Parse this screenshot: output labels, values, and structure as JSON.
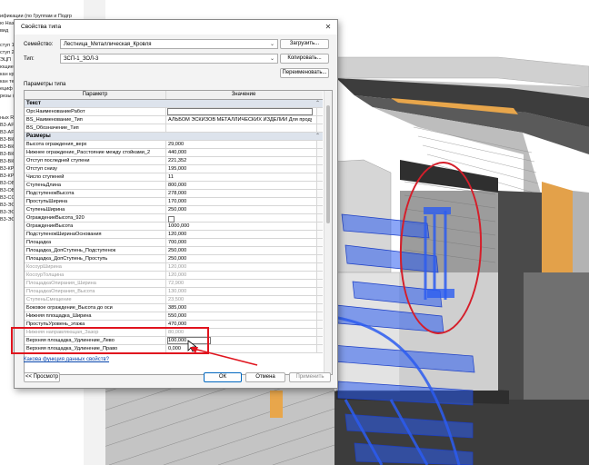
{
  "colors": {
    "accent": "#0067c0",
    "annotation": "#e0141e",
    "group_row": "#dde3ec",
    "concrete_dark": "#3a3a3a",
    "insulation_orange": "#e8a64b",
    "stair_blue": "#2c5cf0"
  },
  "project_browser": {
    "lines": [
      "ификации (по Группам и Подгр",
      "ю Наз",
      "вид",
      "",
      "ступ 1",
      "ступ 2",
      "ЭЦП",
      "ющие",
      "кан кр",
      "кан те",
      "ециф",
      "резы (",
      "",
      "",
      "ных Rev",
      "В3-АР",
      "В3-АР",
      "В3-ВК",
      "В3-ВК",
      "В3-ВК",
      "В3-ВК",
      "В3-КР",
      "В3-КР",
      "В3-ОВ",
      "В3-ОВ",
      "В3-СС",
      "В3-ЭС",
      "В3-ЭС",
      "В3-ЭС"
    ]
  },
  "dialog": {
    "title": "Свойства типа",
    "family_label": "Семейство:",
    "family_value": "Лестница_Металлическая_Кровля",
    "type_label": "Тип:",
    "type_value": "ЗСП-1_ЗОЛ-3",
    "load_button": "Загрузить...",
    "duplicate_button": "Копировать...",
    "rename_button": "Переименовать...",
    "section_label": "Параметры типа",
    "col_param": "Параметр",
    "col_value": "Значение",
    "help_link": "Какова функция данных свойств?",
    "preview_button": "<< Просмотр",
    "ok_button": "ОК",
    "cancel_button": "Отмена",
    "apply_button": "Применить"
  },
  "parameters": [
    {
      "kind": "group",
      "name": "Текст",
      "toggle": "⌃"
    },
    {
      "kind": "param",
      "name": "Орг.НаименованиеРабот",
      "value": "",
      "editing": true
    },
    {
      "kind": "param",
      "name": "BS_Наименование_Тип",
      "value": "АЛЬБОМ ЭСКИЗОВ МЕТАЛЛИЧЕСКИХ ИЗДЕЛИЙ Для продук"
    },
    {
      "kind": "param",
      "name": "BS_Обозначение_Тип",
      "value": ""
    },
    {
      "kind": "group",
      "name": "Размеры",
      "toggle": "⌃"
    },
    {
      "kind": "param",
      "name": "Высота ограждения_верх",
      "value": "29,000"
    },
    {
      "kind": "param",
      "name": "Нижнее ограждение_Расстояние между стойками_2",
      "value": "440,000"
    },
    {
      "kind": "param",
      "name": "Отступ последней ступени",
      "value": "221,352"
    },
    {
      "kind": "param",
      "name": "Отступ снизу",
      "value": "195,000"
    },
    {
      "kind": "param",
      "name": "Число ступеней",
      "value": "11"
    },
    {
      "kind": "param",
      "name": "СтупеньДлина",
      "value": "800,000"
    },
    {
      "kind": "param",
      "name": "ПодступенокВысота",
      "value": "278,000"
    },
    {
      "kind": "param",
      "name": "ПроступьШирина",
      "value": "170,000"
    },
    {
      "kind": "param",
      "name": "СтупеньШирина",
      "value": "250,000"
    },
    {
      "kind": "param",
      "name": "ОграждениеВысота_920",
      "value": "",
      "checkbox": true
    },
    {
      "kind": "param",
      "name": "ОграждениеВысота",
      "value": "1000,000"
    },
    {
      "kind": "param",
      "name": "ПодступенокШиринаОснования",
      "value": "120,000"
    },
    {
      "kind": "param",
      "name": "Площадка",
      "value": "700,000"
    },
    {
      "kind": "param",
      "name": "Площадка_ДопСтупень_Подступенок",
      "value": "250,000"
    },
    {
      "kind": "param",
      "name": "Площадка_ДопСтупень_Проступь",
      "value": "250,000"
    },
    {
      "kind": "param",
      "name": "КосоурШирина",
      "value": "120,000",
      "gray": true
    },
    {
      "kind": "param",
      "name": "КосоурТолщина",
      "value": "120,000",
      "gray": true
    },
    {
      "kind": "param",
      "name": "ПлощадкаОпирания_Ширина",
      "value": "72,900",
      "gray": true
    },
    {
      "kind": "param",
      "name": "ПлощадкаОпирания_Высота",
      "value": "130,000",
      "gray": true
    },
    {
      "kind": "param",
      "name": "СтупеньСмещение",
      "value": "23,500",
      "gray": true
    },
    {
      "kind": "param",
      "name": "Боковое ограждение_Высота до оси",
      "value": "385,000"
    },
    {
      "kind": "param",
      "name": "Нижняя площадка_Ширина",
      "value": "550,000"
    },
    {
      "kind": "param",
      "name": "ПроступьУровень_этажа",
      "value": "470,000"
    },
    {
      "kind": "param",
      "name": "Нижняя направляющая_Зазор",
      "value": "80,000",
      "gray": true
    },
    {
      "kind": "param",
      "name": "Верхняя площадка_Удлинение_Лево",
      "value": "100,000",
      "boxed": true
    },
    {
      "kind": "param",
      "name": "Верхняя площадка_Удлинение_Право",
      "value": "0,000"
    }
  ]
}
